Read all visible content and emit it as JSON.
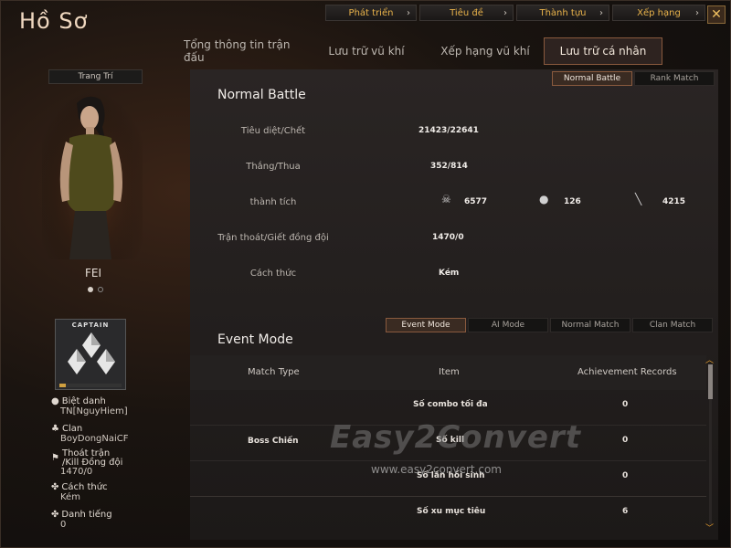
{
  "window": {
    "title": "Hồ Sơ",
    "close": "✕"
  },
  "top_nav": [
    {
      "label": "Phát triển"
    },
    {
      "label": "Tiêu đề"
    },
    {
      "label": "Thành tựu"
    },
    {
      "label": "Xếp hạng"
    }
  ],
  "tabs": [
    {
      "label": "Tổng thông tin trận đấu",
      "active": false
    },
    {
      "label": "Lưu trữ vũ khí",
      "active": false
    },
    {
      "label": "Xếp hạng vũ khí",
      "active": false
    },
    {
      "label": "Lưu trữ cá nhân",
      "active": true
    }
  ],
  "character": {
    "decorate_button": "Trang Trí",
    "name": "FEI",
    "page_dots": 2,
    "active_dot": 0
  },
  "rank_badge": {
    "label": "CAPTAIN",
    "progress": 0.1
  },
  "profile": [
    {
      "label": "Biệt danh",
      "value": "TN[NguyHiem]",
      "icon": "person-icon"
    },
    {
      "label": "Clan",
      "value": "BoyDongNaiCF",
      "icon": "clan-icon"
    },
    {
      "label": "Thoát trận /Kill Đồng đội",
      "value": "1470/0",
      "icon": "runner-icon"
    },
    {
      "label": "Cách thức",
      "value": "Kém",
      "icon": "clover-icon"
    },
    {
      "label": "Danh tiếng",
      "value": "0",
      "icon": "star-icon"
    }
  ],
  "battle_toggle": [
    {
      "label": "Normal Battle",
      "active": true
    },
    {
      "label": "Rank Match",
      "active": false
    }
  ],
  "normal_battle": {
    "title": "Normal Battle",
    "rows": [
      {
        "label": "Tiêu diệt/Chết",
        "value": "21423/22641"
      },
      {
        "label": "Thắng/Thua",
        "value": "352/814"
      },
      {
        "label": "thành tích",
        "value": ""
      },
      {
        "label": "Trận thoát/Giết đồng đội",
        "value": "1470/0"
      },
      {
        "label": "Cách thức",
        "value": "Kém"
      }
    ],
    "achievements": [
      {
        "icon": "skull-icon",
        "value": "6577"
      },
      {
        "icon": "grenade-icon",
        "value": "126"
      },
      {
        "icon": "knife-icon",
        "value": "4215"
      }
    ]
  },
  "event_toggle": [
    {
      "label": "Event Mode",
      "active": true
    },
    {
      "label": "AI Mode",
      "active": false
    },
    {
      "label": "Normal Match",
      "active": false
    },
    {
      "label": "Clan Match",
      "active": false
    }
  ],
  "event_mode": {
    "title": "Event Mode",
    "columns": [
      "Match Type",
      "Item",
      "Achievement Records"
    ],
    "group": "Boss Chiến",
    "rows": [
      {
        "item": "Số combo tối đa",
        "record": "0"
      },
      {
        "item": "Số kill",
        "record": "0"
      },
      {
        "item": "Số lần hồi sinh",
        "record": "0"
      },
      {
        "item": "Số xu mục tiêu",
        "record": "6"
      }
    ]
  },
  "watermark": {
    "brand": "Easy2Convert",
    "url": "www.easy2convert.com"
  },
  "colors": {
    "accent": "#e8b24a",
    "active_border": "#8a5a3e",
    "scroll_arrow": "#e8a030"
  }
}
